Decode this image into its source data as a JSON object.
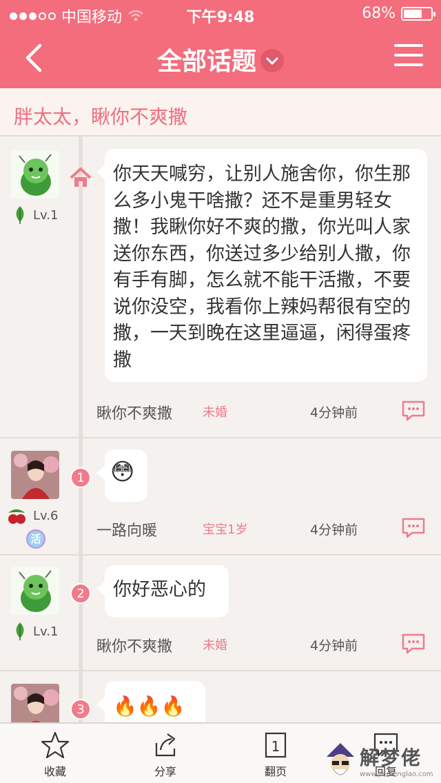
{
  "status_bar": {
    "carrier": "中国移动",
    "time": "下午9:48",
    "battery": "68%",
    "battery_level": 0.68
  },
  "nav": {
    "title": "全部话题"
  },
  "topic": {
    "title": "胖太太，瞅你不爽撒"
  },
  "posts": [
    {
      "level": "Lv.1",
      "content": "你天天喊穷，让别人施舍你，你生那么多小鬼干啥撒？还不是重男轻女撒！我瞅你好不爽的撒，你光叫人家送你东西，你送过多少给别人撒，你有手有脚，怎么就不能干活撒，不要说你没空，我看你上辣妈帮很有空的撒，一天到晚在这里逼逼，闲得蛋疼撒",
      "author": "瞅你不爽撒",
      "status": "未婚",
      "time": "4分钟前"
    },
    {
      "floor": "1",
      "level": "Lv.6",
      "badge_text": "活",
      "content": "😳",
      "author": "一路向暖",
      "status": "宝宝1岁",
      "time": "4分钟前"
    },
    {
      "floor": "2",
      "level": "Lv.1",
      "content": "你好恶心的",
      "author": "瞅你不爽撒",
      "status": "未婚",
      "time": "4分钟前"
    },
    {
      "floor": "3",
      "content": "🔥🔥🔥"
    }
  ],
  "toolbar": {
    "favorite": "收藏",
    "share": "分享",
    "page": "翻页",
    "page_icon_text": "1",
    "reply": "回复"
  },
  "watermark": {
    "text": "解梦佬",
    "url": "www.jiemenglao.com"
  },
  "colors": {
    "accent": "#f36d7d",
    "timeline": "#e5e0dc"
  }
}
